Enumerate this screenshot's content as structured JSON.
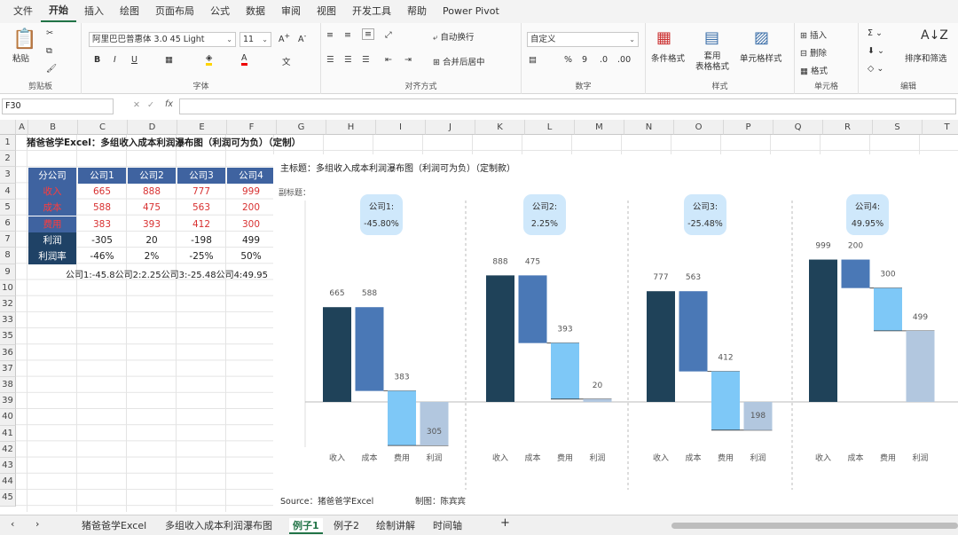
{
  "menu": [
    "文件",
    "开始",
    "插入",
    "绘图",
    "页面布局",
    "公式",
    "数据",
    "审阅",
    "视图",
    "开发工具",
    "帮助",
    "Power Pivot"
  ],
  "ribbon": {
    "paste": "粘贴",
    "clipboard": "剪贴板",
    "font_name": "阿里巴巴普惠体 3.0 45 Light",
    "font_size": "11",
    "font_group": "字体",
    "bold": "B",
    "italic": "I",
    "underline": "U",
    "align_group": "对齐方式",
    "wrap": "自动换行",
    "merge": "合并后居中",
    "number_format": "自定义",
    "number_group": "数字",
    "cond_format": "条件格式",
    "table_format": "套用\n表格格式",
    "cell_style": "单元格样式",
    "style_group": "样式",
    "insert": "插入",
    "delete": "删除",
    "format": "格式",
    "cells_group": "单元格",
    "sort_filter": "排序和筛选",
    "edit_group": "编辑"
  },
  "formula_bar": {
    "name_box": "F30",
    "fx": "fx",
    "value": ""
  },
  "columns": [
    "A",
    "B",
    "C",
    "D",
    "E",
    "F",
    "G",
    "H",
    "I",
    "J",
    "K",
    "L",
    "M",
    "N",
    "O",
    "P",
    "Q",
    "R",
    "S",
    "T"
  ],
  "rows": [
    "1",
    "2",
    "3",
    "4",
    "5",
    "6",
    "7",
    "8",
    "9",
    "10",
    "32",
    "33",
    "35",
    "36",
    "37",
    "38",
    "39",
    "40",
    "41",
    "42",
    "43",
    "44",
    "45"
  ],
  "sheet": {
    "title": "猪爸爸学Excel：多组收入成本利润瀑布图（利润可为负）（定制）",
    "table_header": [
      "分公司",
      "公司1",
      "公司2",
      "公司3",
      "公司4"
    ],
    "table_rows": [
      {
        "label": "收入",
        "values": [
          "665",
          "888",
          "777",
          "999"
        ]
      },
      {
        "label": "成本",
        "values": [
          "588",
          "475",
          "563",
          "200"
        ]
      },
      {
        "label": "费用",
        "values": [
          "383",
          "393",
          "412",
          "300"
        ]
      },
      {
        "label": "利润",
        "values": [
          "-305",
          "20",
          "-198",
          "499"
        ]
      },
      {
        "label": "利润率",
        "values": [
          "-46%",
          "2%",
          "-25%",
          "50%"
        ]
      }
    ],
    "row9_text": "公司1:-45.8公司2:2.25公司3:-25.48公司4:49.95"
  },
  "chart_data": {
    "type": "bar",
    "title": "主标题：多组收入成本利润瀑布图（利润可为负）（定制款）",
    "subtitle": "副标题：",
    "source": "Source：猪爸爸学Excel",
    "author": "制图：陈宾宾",
    "categories": [
      "收入",
      "成本",
      "费用",
      "利润"
    ],
    "groups": [
      {
        "badge": "公司1:",
        "badge_value": "-45.80%",
        "values": [
          665,
          588,
          383,
          305
        ],
        "income": 665,
        "cost": 588,
        "fee": 383,
        "profit": -305
      },
      {
        "badge": "公司2:",
        "badge_value": "2.25%",
        "values": [
          888,
          475,
          393,
          20
        ],
        "income": 888,
        "cost": 475,
        "fee": 393,
        "profit": 20
      },
      {
        "badge": "公司3:",
        "badge_value": "-25.48%",
        "values": [
          777,
          563,
          412,
          198
        ],
        "income": 777,
        "cost": 563,
        "fee": 412,
        "profit": -198
      },
      {
        "badge": "公司4:",
        "badge_value": "49.95%",
        "values": [
          999,
          200,
          300,
          499
        ],
        "income": 999,
        "cost": 200,
        "fee": 300,
        "profit": 499
      }
    ],
    "colors": {
      "income": "#1f4259",
      "cost": "#4a78b6",
      "fee": "#7ec8f7",
      "profit": "#b2c7df",
      "badge": "#cfe8fb"
    }
  },
  "tabs": [
    "猪爸爸学Excel",
    "多组收入成本利润瀑布图",
    "例子1",
    "例子2",
    "绘制讲解",
    "时间轴"
  ],
  "active_tab": "例子1",
  "add_tab": "+"
}
